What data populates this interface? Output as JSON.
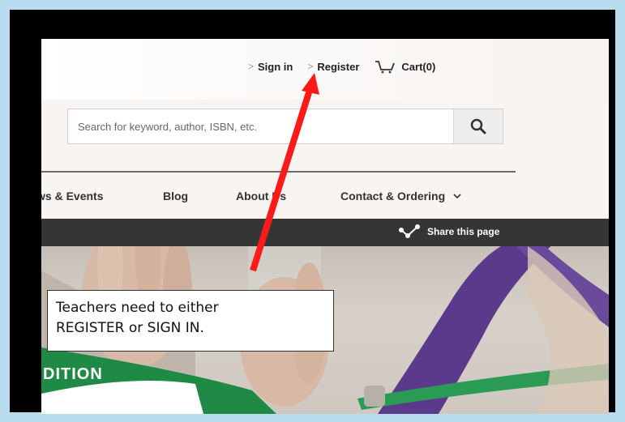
{
  "header": {
    "sign_in": "Sign in",
    "register": "Register",
    "cart": "Cart(0)"
  },
  "search": {
    "placeholder": "Search for keyword, author, ISBN, etc."
  },
  "nav": {
    "items": [
      "ws & Events",
      "Blog",
      "About Us",
      "Contact & Ordering"
    ]
  },
  "share": {
    "label": "Share this page"
  },
  "hero": {
    "text_fragment": "DITION"
  },
  "annotation": {
    "line1": "Teachers need to either",
    "line2": "REGISTER or SIGN IN."
  },
  "colors": {
    "arrow": "#ff1a1a",
    "purple_ribbon": "#5b3a8c",
    "green_band": "#1e8a46",
    "frame": "#000000",
    "background": "#b9dcee"
  }
}
